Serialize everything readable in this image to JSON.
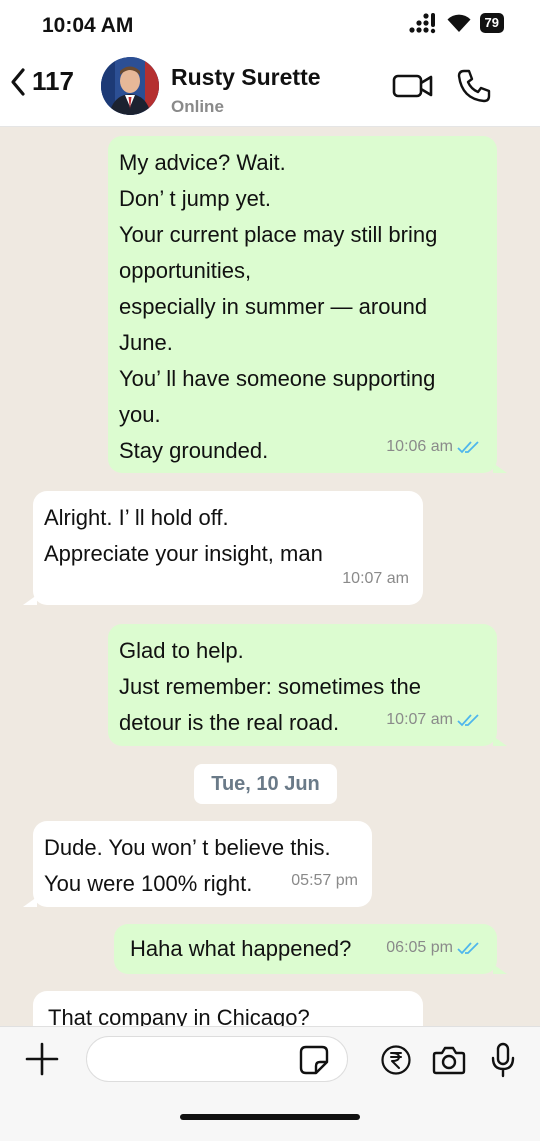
{
  "status_bar": {
    "time": "10:04 AM",
    "battery": "79"
  },
  "header": {
    "back_count": "117",
    "contact_name": "Rusty Surette",
    "contact_status": "Online"
  },
  "messages": [
    {
      "direction": "out",
      "text": "My advice? Wait.\nDon’ t jump yet.\nYour current place may still bring\nopportunities,\nespecially in summer — around\nJune.\nYou’ ll have someone supporting\nyou.\nStay grounded.",
      "time": "10:06 am",
      "read": true
    },
    {
      "direction": "in",
      "text": "Alright. I’ ll hold off.\nAppreciate your insight, man",
      "time": "10:07 am"
    },
    {
      "direction": "out",
      "text": "Glad to help.\nJust remember: sometimes the\ndetour is the real road.",
      "time": "10:07 am",
      "read": true
    },
    {
      "direction": "in",
      "text": "Dude. You won’ t believe this.\nYou were 100% right.",
      "time": "05:57 pm"
    },
    {
      "direction": "out",
      "text": "Haha what happened?",
      "time": "06:05 pm",
      "read": true
    },
    {
      "direction": "in",
      "text": "That company in Chicago?",
      "time": ""
    }
  ],
  "date_divider": "Tue, 10 Jun",
  "input": {
    "placeholder": ""
  },
  "colors": {
    "outgoing_bubble": "#dcfcd0",
    "incoming_bubble": "#ffffff",
    "read_tick": "#4fb6ec",
    "chat_background": "#efe9e1"
  }
}
